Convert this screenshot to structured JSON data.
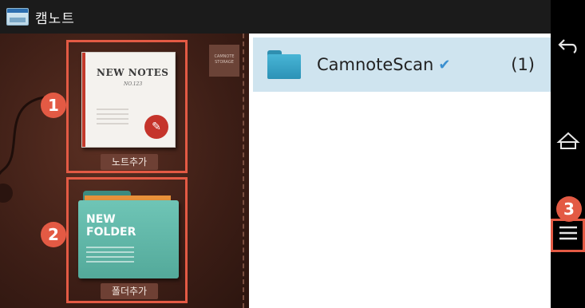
{
  "status_bar": {
    "app_icon": "camnote-app-icon",
    "app_title": "캠노트"
  },
  "left_panel": {
    "storage_tab_text": "CAMNOTE STORAGE",
    "add_note": {
      "cover_title": "NEW NOTES",
      "cover_number": "NO.123",
      "badge_icon": "pen-nib-icon",
      "label": "노트추가"
    },
    "add_folder": {
      "cover_title_line1": "NEW",
      "cover_title_line2": "FOLDER",
      "label": "폴더추가"
    }
  },
  "main_list": {
    "items": [
      {
        "icon": "folder-icon",
        "name": "CamnoteScan",
        "status_icon": "check-icon",
        "count": "(1)"
      }
    ]
  },
  "nav_bar": {
    "back_icon": "back-arrow-icon",
    "home_icon": "home-icon",
    "menu_icon": "hamburger-menu-icon"
  },
  "callouts": {
    "marker_1": "1",
    "marker_2": "2",
    "marker_3": "3"
  },
  "colors": {
    "callout_accent": "#e35a44",
    "selected_row": "#cfe4ef",
    "panel_leather": "#3d1e16"
  }
}
